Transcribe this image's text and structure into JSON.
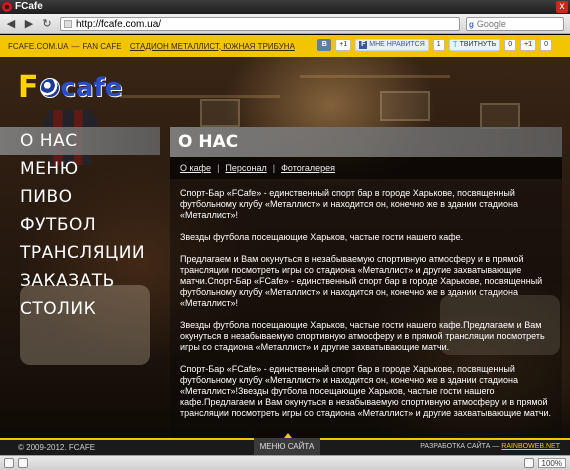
{
  "window": {
    "title": "FCafe",
    "close_glyph": "x"
  },
  "toolbar": {
    "back_glyph": "◀",
    "forward_glyph": "▶",
    "reload_glyph": "↻",
    "url": "http://fcafe.com.ua/",
    "search_placeholder": "Google",
    "search_engine_glyph": "g"
  },
  "topbar": {
    "site": "FCAFE.COM.UA",
    "sep": "—",
    "section": "FAN CAFE",
    "link": "СТАДИОН МЕТАЛЛИСТ, ЮЖНАЯ ТРИБУНА"
  },
  "social": {
    "vk_label": "В",
    "vk_count": "+1",
    "fb_glyph": "f",
    "fb_label": "Мне нравится",
    "fb_count": "1",
    "tw_glyph": "t",
    "tw_label": "Твитнуть",
    "tw_count": "0",
    "gp_label": "+1",
    "gp_count": "0"
  },
  "logo": {
    "first": "F",
    "rest": "cafe"
  },
  "nav": [
    {
      "label": "О НАС",
      "active": true
    },
    {
      "label": "МЕНЮ",
      "active": false
    },
    {
      "label": "ПИВО",
      "active": false
    },
    {
      "label": "ФУТБОЛ",
      "active": false
    },
    {
      "label": "ТРАНСЛЯЦИИ",
      "active": false
    },
    {
      "label": "ЗАКАЗАТЬ СТОЛИК",
      "active": false
    }
  ],
  "panel": {
    "title": "О НАС",
    "tabs": [
      "О кафе",
      "Персонал",
      "Фотогалерея"
    ],
    "tab_sep": "|",
    "paragraphs": [
      "Спорт-Бар «FCafe» - единственный спорт бар в городе Харькове, посвященный футбольному клубу «Металлист» и находится он, конечно же в здании стадиона «Металлист»!",
      "Звезды футбола посещающие Харьков, частые гости нашего кафе.",
      "Предлагаем и Вам окунуться в незабываемую спортивную атмосферу и в прямой трансляции посмотреть игры со стадиона «Металлист» и другие захватывающие матчи.Спорт-Бар «FCafe» - единственный спорт бар в городе Харькове, посвященный футбольному клубу «Металлист» и находится он, конечно же в здании стадиона «Металлист»!",
      "Звезды футбола посещающие Харьков, частые гости нашего кафе.Предлагаем и Вам окунуться в незабываемую спортивную атмосферу и в прямой трансляции посмотреть игры со стадиона «Металлист» и другие захватывающие матчи.",
      "Спорт-Бар «FCafe» - единственный спорт бар в городе Харькове, посвященный футбольному клубу «Металлист» и находится он, конечно же в здании стадиона «Металлист»!Звезды футбола посещающие Харьков, частые гости нашего кафе.Предлагаем и Вам окунуться в незабываемую спортивную атмосферу и в прямой трансляции посмотреть игры со стадиона «Металлист» и другие захватывающие матчи."
    ]
  },
  "footer": {
    "copyright": "© 2009-2012. FCAFE",
    "menu_label": "МЕНЮ САЙТА",
    "credit_prefix": "РАЗРАБОТКА САЙТА —",
    "credit_link": "RAINBOWEB.NET"
  },
  "statusbar": {
    "zoom": "100%"
  },
  "colors": {
    "accent": "#f2c500",
    "logo_blue": "#2a4cc4",
    "footer_bg": "#1a1a1a"
  },
  "icons": [
    "opera-icon",
    "back-icon",
    "forward-icon",
    "reload-icon",
    "page-icon",
    "google-icon",
    "close-icon",
    "soccer-ball-icon",
    "panel-icon",
    "zoom-icon"
  ]
}
